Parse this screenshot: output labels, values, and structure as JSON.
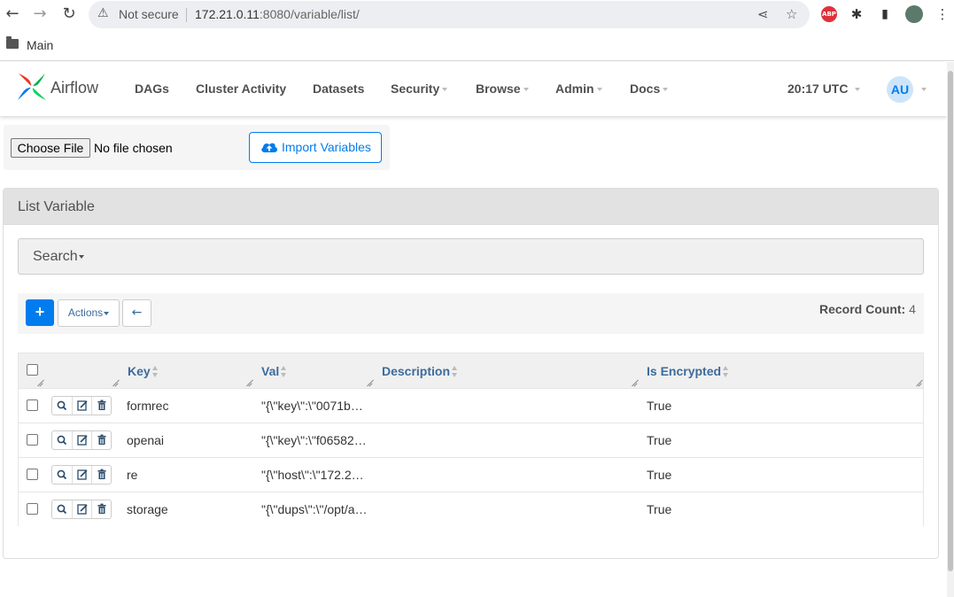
{
  "browser": {
    "security_label": "Not secure",
    "url_host": "172.21.0.11",
    "url_rest": ":8080/variable/list/",
    "bookmark": "Main",
    "abp_label": "ABP"
  },
  "navbar": {
    "brand": "Airflow",
    "items": [
      "DAGs",
      "Cluster Activity",
      "Datasets",
      "Security",
      "Browse",
      "Admin",
      "Docs"
    ],
    "clock": "20:17 UTC",
    "avatar": "AU"
  },
  "import": {
    "choose_file": "Choose File",
    "no_file": "No file chosen",
    "button": "Import Variables"
  },
  "panel": {
    "title": "List Variable",
    "search": "Search"
  },
  "toolbar": {
    "add": "+",
    "actions": "Actions",
    "back": "←",
    "record_count_label": "Record Count:",
    "record_count": "4"
  },
  "table": {
    "headers": [
      "Key",
      "Val",
      "Description",
      "Is Encrypted"
    ],
    "rows": [
      {
        "key": "formrec",
        "val": "\"{\\\"key\\\":\\\"0071b…",
        "description": "",
        "encrypted": "True"
      },
      {
        "key": "openai",
        "val": "\"{\\\"key\\\":\\\"f06582…",
        "description": "",
        "encrypted": "True"
      },
      {
        "key": "re",
        "val": "\"{\\\"host\\\":\\\"172.2…",
        "description": "",
        "encrypted": "True"
      },
      {
        "key": "storage",
        "val": "\"{\\\"dups\\\":\\\"/opt/a…",
        "description": "",
        "encrypted": "True"
      }
    ]
  },
  "colors": {
    "primary": "#017cee",
    "link": "#3d6b9c",
    "nav_text": "#51504f"
  }
}
